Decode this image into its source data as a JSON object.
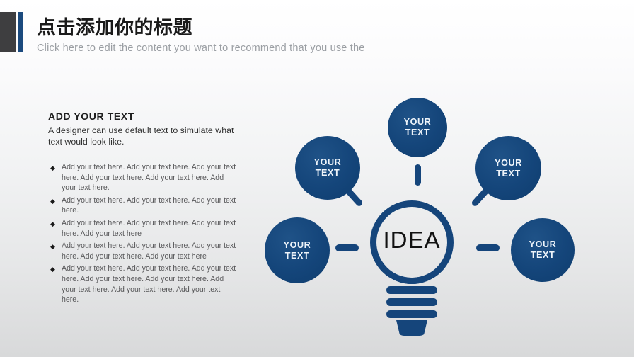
{
  "header": {
    "title": "点击添加你的标题",
    "subtitle": "Click here to edit the content you want to recommend that you use the",
    "accent_dark": "#3e3e40",
    "accent_blue": "#1b4a7e"
  },
  "left_panel": {
    "heading": "ADD YOUR TEXT",
    "subtext": "A designer can use default text to simulate what text would look like.",
    "bullet_marker": "◆",
    "bullets": [
      "Add your text here. Add your text here. Add your text here. Add your text here. Add your text here. Add your text here.",
      "Add your text here. Add your text here. Add your text here.",
      "Add your text here. Add your text here. Add your text here. Add your text here",
      "Add your text here. Add your text here. Add your text here. Add your text here. Add your text here",
      "Add your text here. Add your text here. Add your text here. Add your text here. Add your text here. Add your text here. Add your text here. Add your text here."
    ]
  },
  "diagram": {
    "center_label": "IDEA",
    "node_color": "#14457a",
    "node_text_color": "#eef4fa",
    "bulb_color": "#15457b",
    "nodes": [
      {
        "id": "top",
        "line1": "YOUR",
        "line2": "TEXT"
      },
      {
        "id": "upper-left",
        "line1": "YOUR",
        "line2": "TEXT"
      },
      {
        "id": "upper-right",
        "line1": "YOUR",
        "line2": "TEXT"
      },
      {
        "id": "lower-left",
        "line1": "YOUR",
        "line2": "TEXT"
      },
      {
        "id": "lower-right",
        "line1": "YOUR",
        "line2": "TEXT"
      }
    ]
  }
}
